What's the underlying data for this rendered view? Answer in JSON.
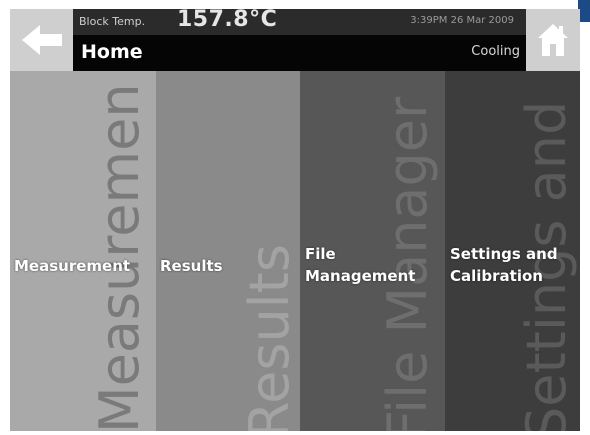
{
  "colors": {
    "accent": "#1c4a86",
    "header_bg": "#050505",
    "tile_measurement": "#a9a9a9",
    "tile_results": "#8a8a8a",
    "tile_file": "#575757",
    "tile_settings": "#3d3d3d"
  },
  "header": {
    "back_icon": "arrow-left-icon",
    "home_icon": "house-icon",
    "block_temp_label": "Block Temp.",
    "block_temp_value": "157.8°C",
    "datetime": "3:39PM 26 Mar 2009",
    "title": "Home",
    "state": "Cooling"
  },
  "menu": {
    "items": [
      {
        "label_line1": "Measurement",
        "label_line2": "",
        "ghost": "Measuremen"
      },
      {
        "label_line1": "Results",
        "label_line2": "",
        "ghost": "Results"
      },
      {
        "label_line1": "File",
        "label_line2": "Management",
        "ghost": "File Manager"
      },
      {
        "label_line1": "Settings and",
        "label_line2": "Calibration",
        "ghost": "Settings and"
      }
    ]
  }
}
